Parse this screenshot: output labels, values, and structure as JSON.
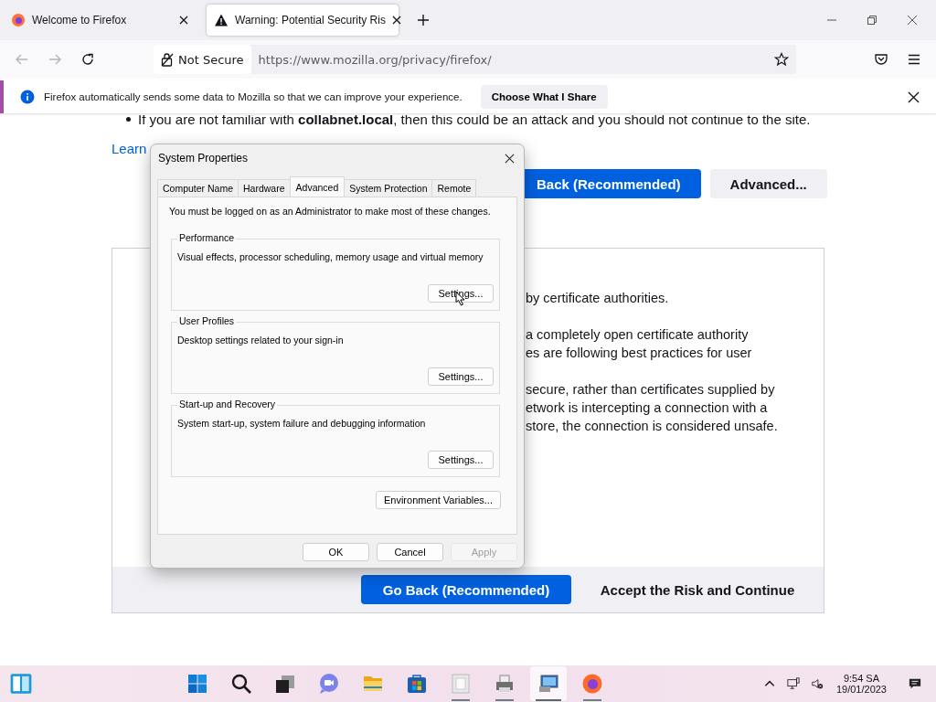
{
  "browser": {
    "tabs": [
      {
        "title": "Welcome to Firefox",
        "selected": false
      },
      {
        "title": "Warning: Potential Security Ris",
        "selected": true
      }
    ],
    "security_label": "Not Secure",
    "url": "https://www.mozilla.org/privacy/firefox/",
    "notification": {
      "text": "Firefox automatically sends some data to Mozilla so that we can improve your experience.",
      "button": "Choose What I Share"
    }
  },
  "page": {
    "bullet": "If you are not familiar with **collabnet.local**, then this could be an attack and you should not continue to the site.",
    "link": "Learn",
    "top_buttons": [
      {
        "label": "Back (Recommended)",
        "kind": "primary"
      },
      {
        "label": "Advanced...",
        "kind": "secondary"
      }
    ],
    "paragraphs": [
      [
        "by certificate authorities."
      ],
      [
        "a completely open certificate authority",
        "es are following best practices for user"
      ],
      [
        "secure, rather than certificates supplied by",
        "etwork is intercepting a connection with a",
        "store, the connection is considered unsafe."
      ]
    ],
    "footer_buttons": [
      {
        "label": "Go Back (Recommended)",
        "kind": "primary"
      },
      {
        "label": "Accept the Risk and Continue",
        "kind": "secondary"
      }
    ]
  },
  "dialog": {
    "title": "System Properties",
    "tabs": [
      {
        "label": "Computer Name",
        "selected": false
      },
      {
        "label": "Hardware",
        "selected": false
      },
      {
        "label": "Advanced",
        "selected": true
      },
      {
        "label": "System Protection",
        "selected": false
      },
      {
        "label": "Remote",
        "selected": false
      }
    ],
    "notice": "You must be logged on as an Administrator to make most of these changes.",
    "groups": [
      {
        "title": "Performance",
        "description": "Visual effects, processor scheduling, memory usage and virtual memory",
        "button": "Settings..."
      },
      {
        "title": "User Profiles",
        "description": "Desktop settings related to your sign-in",
        "button": "Settings..."
      },
      {
        "title": "Start-up and Recovery",
        "description": "System start-up, system failure and debugging information",
        "button": "Settings..."
      }
    ],
    "env_button": "Environment Variables...",
    "buttons": [
      {
        "label": "OK",
        "disabled": false
      },
      {
        "label": "Cancel",
        "disabled": false
      },
      {
        "label": "Apply",
        "disabled": true
      }
    ]
  },
  "taskbar": {
    "apps": [
      {
        "kind": "start",
        "running": false,
        "selected": false
      },
      {
        "kind": "search",
        "running": false,
        "selected": false
      },
      {
        "kind": "taskview",
        "running": false,
        "selected": false
      },
      {
        "kind": "chat",
        "running": false,
        "selected": false
      },
      {
        "kind": "folder",
        "running": false,
        "selected": false
      },
      {
        "kind": "store",
        "running": false,
        "selected": false
      },
      {
        "kind": "document",
        "running": true,
        "selected": false
      },
      {
        "kind": "printer",
        "running": true,
        "selected": false
      },
      {
        "kind": "computer",
        "running": true,
        "selected": true
      },
      {
        "kind": "firefox",
        "running": true,
        "selected": false
      }
    ],
    "time": "9:54 SA",
    "date": "19/01/2023"
  }
}
